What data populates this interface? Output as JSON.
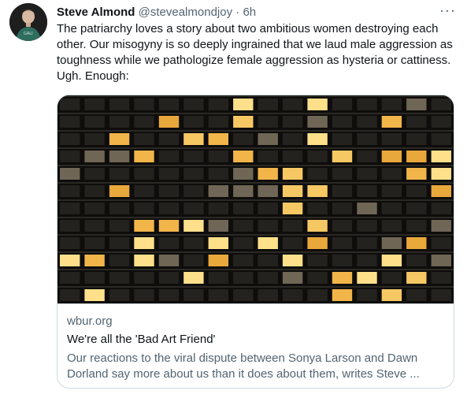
{
  "tweet": {
    "author_name": "Steve Almond",
    "handle": "@stevealmondjoy",
    "separator": "·",
    "time": "6h",
    "more_label": "···",
    "text": "The patriarchy loves a story about two ambitious women destroying each other. Our misogyny is so deeply ingrained that we laud male aggression as toughness while we pathologize female aggression as hysteria or cattiness. Ugh. Enough:"
  },
  "card": {
    "domain": "wbur.org",
    "title": "We're all the 'Bad Art Friend'",
    "description": "Our reactions to the viral dispute between Sonya Larson and Dawn Dorland say more about us than it does about them, writes Steve ..."
  },
  "colors": {
    "text_primary": "#0f1419",
    "text_secondary": "#536471",
    "border": "#cfd9de",
    "window_light": "#f3c45f"
  }
}
